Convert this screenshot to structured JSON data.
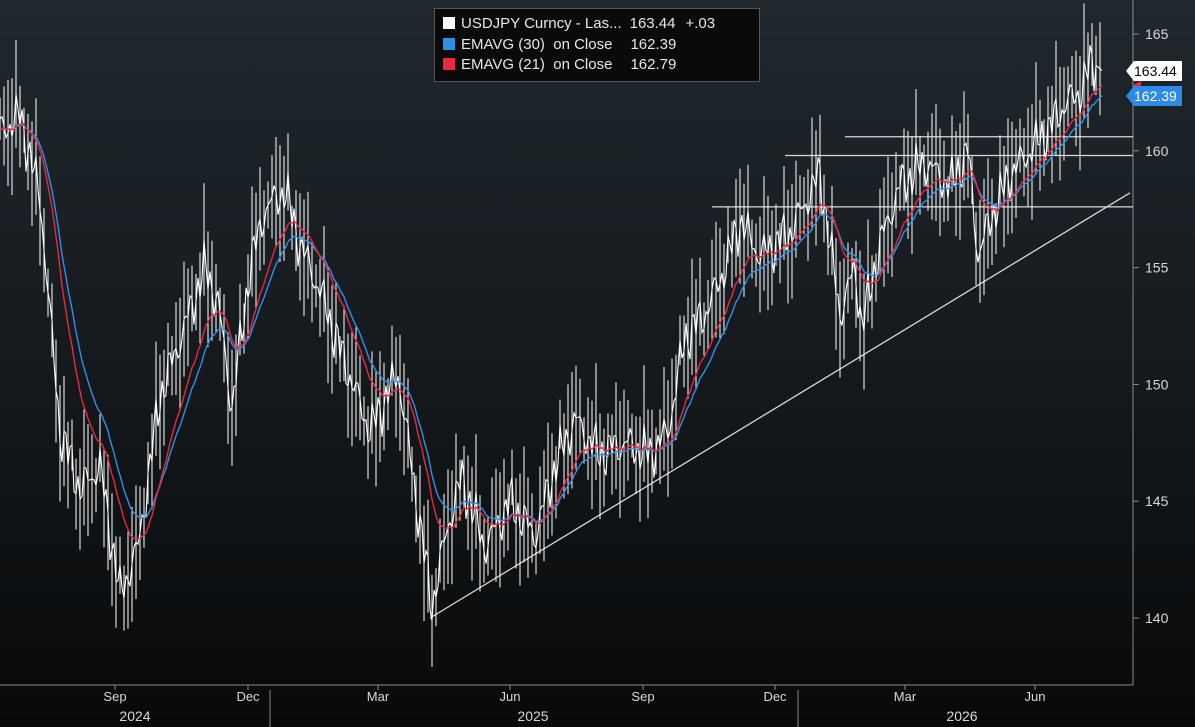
{
  "chart_data": {
    "type": "line",
    "y_ticks": [
      140,
      145,
      150,
      155,
      160,
      165
    ],
    "ylim": [
      137.5,
      166.5
    ],
    "x_month_ticks": [
      "Sep",
      "Dec",
      "Mar",
      "Jun",
      "Sep",
      "Dec",
      "Mar",
      "Jun"
    ],
    "x_year_labels": [
      "2024",
      "2025",
      "2026"
    ],
    "series": [
      {
        "name": "USDJPY Curncy - Las...",
        "value": "163.44",
        "change": "+.03",
        "color": "#ffffff",
        "keypoints": [
          {
            "x": 0,
            "y": 160.8
          },
          {
            "x": 20,
            "y": 161.5
          },
          {
            "x": 40,
            "y": 158.0
          },
          {
            "x": 60,
            "y": 148.0
          },
          {
            "x": 80,
            "y": 145.5
          },
          {
            "x": 100,
            "y": 146.5
          },
          {
            "x": 120,
            "y": 141.0
          },
          {
            "x": 138,
            "y": 143.0
          },
          {
            "x": 160,
            "y": 149.5
          },
          {
            "x": 185,
            "y": 152.5
          },
          {
            "x": 205,
            "y": 155.0
          },
          {
            "x": 218,
            "y": 153.5
          },
          {
            "x": 232,
            "y": 149.0
          },
          {
            "x": 250,
            "y": 155.0
          },
          {
            "x": 265,
            "y": 157.5
          },
          {
            "x": 285,
            "y": 158.3
          },
          {
            "x": 300,
            "y": 156.0
          },
          {
            "x": 320,
            "y": 154.0
          },
          {
            "x": 340,
            "y": 151.5
          },
          {
            "x": 370,
            "y": 148.0
          },
          {
            "x": 398,
            "y": 150.5
          },
          {
            "x": 420,
            "y": 144.0
          },
          {
            "x": 432,
            "y": 140.5
          },
          {
            "x": 448,
            "y": 144.0
          },
          {
            "x": 462,
            "y": 146.0
          },
          {
            "x": 485,
            "y": 143.0
          },
          {
            "x": 510,
            "y": 145.0
          },
          {
            "x": 535,
            "y": 143.5
          },
          {
            "x": 555,
            "y": 146.5
          },
          {
            "x": 575,
            "y": 148.5
          },
          {
            "x": 600,
            "y": 147.0
          },
          {
            "x": 625,
            "y": 147.5
          },
          {
            "x": 650,
            "y": 147.0
          },
          {
            "x": 668,
            "y": 148.0
          },
          {
            "x": 685,
            "y": 152.0
          },
          {
            "x": 705,
            "y": 153.0
          },
          {
            "x": 725,
            "y": 155.0
          },
          {
            "x": 740,
            "y": 157.0
          },
          {
            "x": 760,
            "y": 155.5
          },
          {
            "x": 790,
            "y": 156.5
          },
          {
            "x": 820,
            "y": 159.0
          },
          {
            "x": 840,
            "y": 153.0
          },
          {
            "x": 855,
            "y": 155.0
          },
          {
            "x": 862,
            "y": 152.5
          },
          {
            "x": 880,
            "y": 156.0
          },
          {
            "x": 900,
            "y": 158.5
          },
          {
            "x": 925,
            "y": 159.5
          },
          {
            "x": 950,
            "y": 158.5
          },
          {
            "x": 968,
            "y": 160.0
          },
          {
            "x": 978,
            "y": 155.5
          },
          {
            "x": 990,
            "y": 157.0
          },
          {
            "x": 1010,
            "y": 159.0
          },
          {
            "x": 1030,
            "y": 160.0
          },
          {
            "x": 1050,
            "y": 161.0
          },
          {
            "x": 1065,
            "y": 162.0
          },
          {
            "x": 1080,
            "y": 162.5
          },
          {
            "x": 1092,
            "y": 163.8
          },
          {
            "x": 1102,
            "y": 163.44
          }
        ]
      },
      {
        "name": "EMAVG (30)  on Close",
        "value": "162.39",
        "color": "#2e8fe8",
        "alpha": 0.065
      },
      {
        "name": "EMAVG (21)  on Close",
        "value": "162.79",
        "color": "#e8283c",
        "alpha": 0.09
      }
    ],
    "trendline": {
      "from": {
        "x": 430,
        "y": 140.0
      },
      "to": {
        "x": 1130,
        "y": 158.2
      }
    },
    "resistance_lines": [
      {
        "x_from": 712,
        "x_to": 1133,
        "y": 157.6
      },
      {
        "x_from": 785,
        "x_to": 1133,
        "y": 159.8
      },
      {
        "x_from": 845,
        "x_to": 1133,
        "y": 160.6
      }
    ],
    "last_price_tag": "163.44",
    "ema_tag": "162.39"
  }
}
